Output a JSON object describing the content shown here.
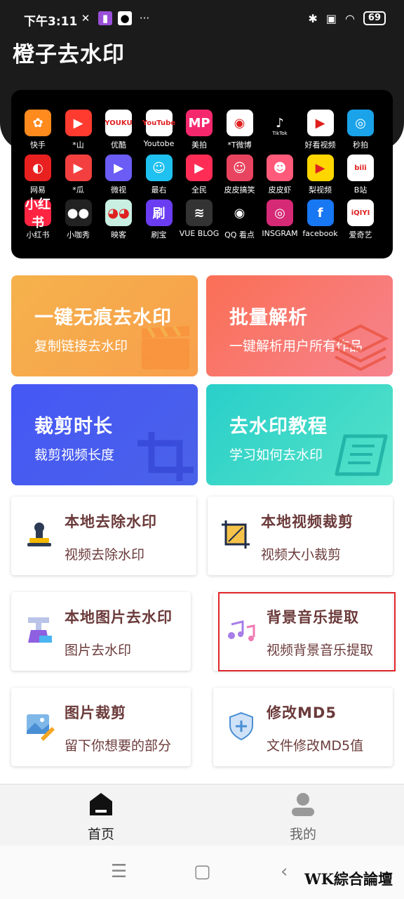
{
  "status": {
    "time": "下午3:11",
    "battery": "69"
  },
  "app_title": "橙子去水印",
  "platforms": [
    {
      "label": "快手",
      "icon": "kuaishou-icon",
      "color": "#ff8a1e",
      "glyph": "✿"
    },
    {
      "label": "*山",
      "icon": "huoshan-icon",
      "color": "#ff3b2f",
      "glyph": "▶"
    },
    {
      "label": "优酷",
      "icon": "youku-icon",
      "color": "#ffffff",
      "glyph": "YOUKU"
    },
    {
      "label": "Youtobe",
      "icon": "youtube-icon",
      "color": "#ffffff",
      "glyph": "YouTube"
    },
    {
      "label": "美拍",
      "icon": "meipai-icon",
      "color": "#f5286e",
      "glyph": "MP"
    },
    {
      "label": "*T微博",
      "icon": "weibo-icon",
      "color": "#ffffff",
      "glyph": "◉"
    },
    {
      "label": "",
      "icon": "tiktok-icon",
      "color": "#000000",
      "glyph": "♪"
    },
    {
      "label": "好看视频",
      "icon": "haokan-icon",
      "color": "#ffffff",
      "glyph": "▶"
    },
    {
      "label": "秒拍",
      "icon": "miaopai-icon",
      "color": "#1aa3e8",
      "glyph": "◎"
    },
    {
      "label": "网易",
      "icon": "netease-icon",
      "color": "#e8201f",
      "glyph": "◐"
    },
    {
      "label": "*瓜",
      "icon": "xigua-icon",
      "color": "#f33f3f",
      "glyph": "▶"
    },
    {
      "label": "微视",
      "icon": "weishi-icon",
      "color": "#6a5cf5",
      "glyph": "▶"
    },
    {
      "label": "最右",
      "icon": "zuiyou-icon",
      "color": "#1ec1f0",
      "glyph": "☺"
    },
    {
      "label": "全民",
      "icon": "quanmin-icon",
      "color": "#ff2d55",
      "glyph": "▶"
    },
    {
      "label": "皮皮搞笑",
      "icon": "pipigaoxiao-icon",
      "color": "#e9445f",
      "glyph": "☺"
    },
    {
      "label": "皮皮虾",
      "icon": "pipixia-icon",
      "color": "#ff5a7a",
      "glyph": "☻"
    },
    {
      "label": "梨视频",
      "icon": "lishipin-icon",
      "color": "#ffd600",
      "glyph": "▶"
    },
    {
      "label": "B站",
      "icon": "bilibili-icon",
      "color": "#ffffff",
      "glyph": "bili"
    },
    {
      "label": "小红书",
      "icon": "xiaohongshu-icon",
      "color": "#ff2442",
      "glyph": "小红书"
    },
    {
      "label": "小咖秀",
      "icon": "xiaokaxiu-icon",
      "color": "#222222",
      "glyph": "●●"
    },
    {
      "label": "映客",
      "icon": "yingke-icon",
      "color": "#c8efe1",
      "glyph": "◕◕"
    },
    {
      "label": "刷宝",
      "icon": "shuabao-icon",
      "color": "#6a3df2",
      "glyph": "刷"
    },
    {
      "label": "VUE BLOG",
      "icon": "vue-blog-icon",
      "color": "#333333",
      "glyph": "≋"
    },
    {
      "label": "QQ 看点",
      "icon": "qq-kandian-icon",
      "color": "#000000",
      "glyph": "◉"
    },
    {
      "label": "INSGRAM",
      "icon": "instagram-icon",
      "color": "#d62976",
      "glyph": "◎"
    },
    {
      "label": "facebook",
      "icon": "facebook-icon",
      "color": "#1877f2",
      "glyph": "f"
    },
    {
      "label": "爱奇艺",
      "icon": "iqiyi-icon",
      "color": "#ffffff",
      "glyph": "iQIYI"
    }
  ],
  "tiktok_caption": "TikTok",
  "tiles": [
    {
      "title": "一键无痕去水印",
      "subtitle": "复制链接去水印",
      "icon": "clapperboard-icon"
    },
    {
      "title": "批量解析",
      "subtitle": "一键解析用户所有作品",
      "icon": "layers-icon"
    },
    {
      "title": "裁剪时长",
      "subtitle": "裁剪视频长度",
      "icon": "crop-icon"
    },
    {
      "title": "去水印教程",
      "subtitle": "学习如何去水印",
      "icon": "book-icon"
    }
  ],
  "cards": [
    {
      "title": "本地去除水印",
      "subtitle": "视频去除水印",
      "icon": "stamp-icon"
    },
    {
      "title": "本地视频裁剪",
      "subtitle": "视频大小裁剪",
      "icon": "video-crop-icon"
    },
    {
      "title": "本地图片去水印",
      "subtitle": "图片去水印",
      "icon": "image-clean-icon"
    },
    {
      "title": "背景音乐提取",
      "subtitle": "视频背景音乐提取",
      "icon": "music-note-icon"
    },
    {
      "title": "图片裁剪",
      "subtitle": "留下你想要的部分",
      "icon": "image-edit-icon"
    },
    {
      "title": "修改MD5",
      "subtitle": "文件修改MD5值",
      "icon": "shield-plus-icon"
    }
  ],
  "nav": {
    "home": "首页",
    "mine": "我的"
  },
  "watermark": "WK綜合論壇",
  "colors": {
    "accent_text": "#6b3a3a",
    "highlight": "#e0262b"
  }
}
